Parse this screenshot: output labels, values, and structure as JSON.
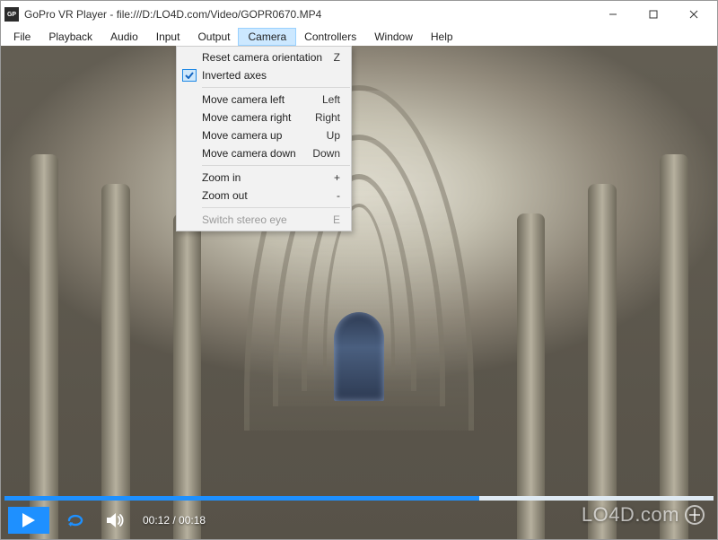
{
  "titlebar": {
    "icon_label": "GoPro",
    "title": "GoPro VR Player - file:///D:/LO4D.com/Video/GOPR0670.MP4"
  },
  "menubar": {
    "items": [
      "File",
      "Playback",
      "Audio",
      "Input",
      "Output",
      "Camera",
      "Controllers",
      "Window",
      "Help"
    ],
    "active_index": 5
  },
  "dropdown": {
    "items": [
      {
        "label": "Reset camera orientation",
        "shortcut": "Z",
        "checked": false,
        "disabled": false
      },
      {
        "label": "Inverted axes",
        "shortcut": "",
        "checked": true,
        "disabled": false
      },
      {
        "sep": true
      },
      {
        "label": "Move camera left",
        "shortcut": "Left",
        "checked": false,
        "disabled": false
      },
      {
        "label": "Move camera right",
        "shortcut": "Right",
        "checked": false,
        "disabled": false
      },
      {
        "label": "Move camera up",
        "shortcut": "Up",
        "checked": false,
        "disabled": false
      },
      {
        "label": "Move camera down",
        "shortcut": "Down",
        "checked": false,
        "disabled": false
      },
      {
        "sep": true
      },
      {
        "label": "Zoom in",
        "shortcut": "+",
        "checked": false,
        "disabled": false
      },
      {
        "label": "Zoom out",
        "shortcut": "-",
        "checked": false,
        "disabled": false
      },
      {
        "sep": true
      },
      {
        "label": "Switch stereo eye",
        "shortcut": "E",
        "checked": false,
        "disabled": true
      }
    ]
  },
  "player": {
    "current_time": "00:12",
    "total_time": "00:18",
    "time_display": "00:12 / 00:18",
    "progress_percent": 67
  },
  "watermark": {
    "text": "LO4D.com"
  }
}
